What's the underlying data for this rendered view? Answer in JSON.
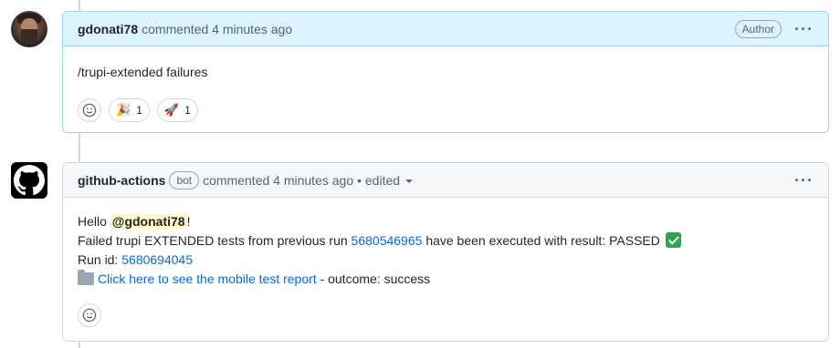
{
  "comment1": {
    "author": "gdonati78",
    "meta": "commented 4 minutes ago",
    "badge": "Author",
    "body": "/trupi-extended failures",
    "reactions": [
      {
        "emoji": "🎉",
        "count": "1"
      },
      {
        "emoji": "🚀",
        "count": "1"
      }
    ]
  },
  "comment2": {
    "author": "github-actions",
    "badge": "bot",
    "meta": "commented 4 minutes ago",
    "edited": "• edited",
    "greeting": "Hello",
    "mention": "@gdonati78",
    "exclaim": "!",
    "line2_prefix": "Failed trupi EXTENDED tests from previous run",
    "run_link": "5680546965",
    "line2_suffix": "have been executed with result: PASSED",
    "run_id_label": "Run id:",
    "run_id": "5680694045",
    "report_link": "Click here to see the mobile test report",
    "outcome": "- outcome: success"
  },
  "icons": {
    "kebab": "···"
  }
}
